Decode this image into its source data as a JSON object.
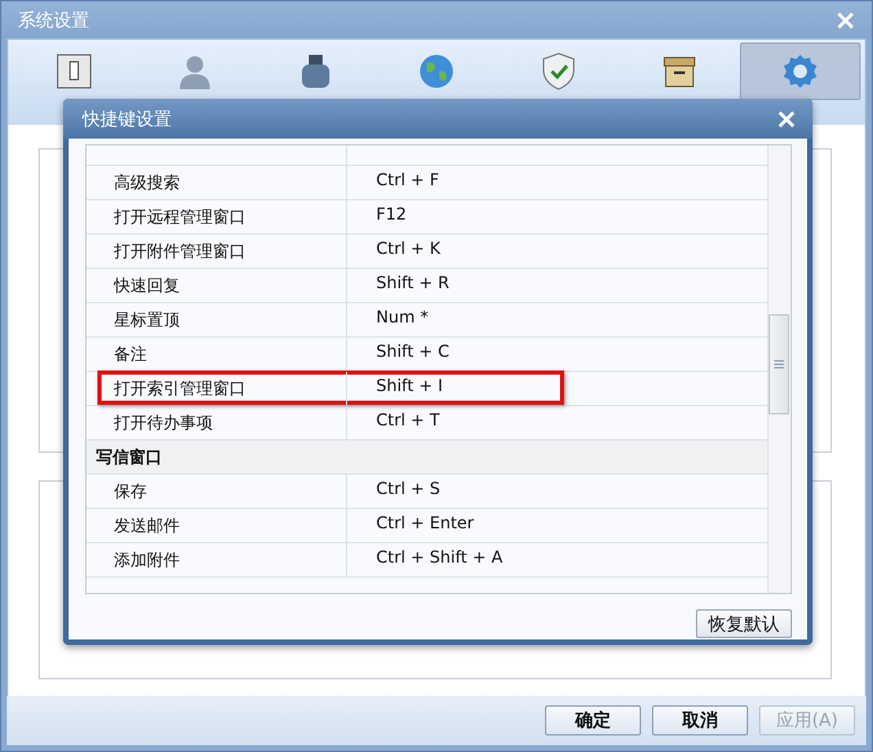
{
  "window": {
    "title": "系统设置"
  },
  "tabs": [
    {
      "selected": false
    },
    {
      "selected": false
    },
    {
      "selected": false
    },
    {
      "selected": false
    },
    {
      "selected": false
    },
    {
      "selected": false
    },
    {
      "selected": true
    }
  ],
  "dialog": {
    "title": "快捷键设置",
    "rows": [
      {
        "kind": "shortcut",
        "action": "高级搜索",
        "keys": "Ctrl + F",
        "highlighted": false
      },
      {
        "kind": "shortcut",
        "action": "打开远程管理窗口",
        "keys": "F12",
        "highlighted": false
      },
      {
        "kind": "shortcut",
        "action": "打开附件管理窗口",
        "keys": "Ctrl + K",
        "highlighted": false
      },
      {
        "kind": "shortcut",
        "action": "快速回复",
        "keys": "Shift + R",
        "highlighted": false
      },
      {
        "kind": "shortcut",
        "action": "星标置顶",
        "keys": "Num *",
        "highlighted": false
      },
      {
        "kind": "shortcut",
        "action": "备注",
        "keys": "Shift + C",
        "highlighted": false
      },
      {
        "kind": "shortcut",
        "action": "打开索引管理窗口",
        "keys": "Shift + I",
        "highlighted": true
      },
      {
        "kind": "shortcut",
        "action": "打开待办事项",
        "keys": "Ctrl + T",
        "highlighted": false
      },
      {
        "kind": "group",
        "action": "写信窗口"
      },
      {
        "kind": "shortcut",
        "action": "保存",
        "keys": "Ctrl + S",
        "highlighted": false
      },
      {
        "kind": "shortcut",
        "action": "发送邮件",
        "keys": "Ctrl + Enter",
        "highlighted": false
      },
      {
        "kind": "shortcut",
        "action": "添加附件",
        "keys": "Ctrl + Shift + A",
        "highlighted": false
      }
    ],
    "restore_button": "恢复默认"
  },
  "buttons": [
    {
      "label": "确定",
      "disabled": false
    },
    {
      "label": "取消",
      "disabled": false
    },
    {
      "label": "应用(A)",
      "disabled": true
    }
  ]
}
